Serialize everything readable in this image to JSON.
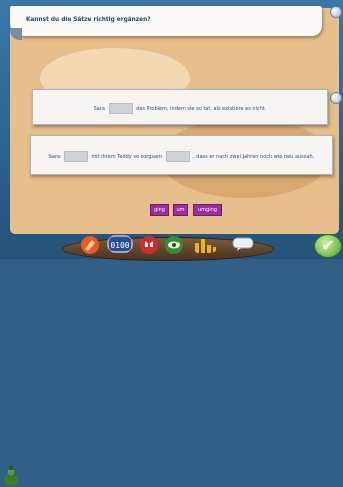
{
  "instruction": "Kannst du die Sätze richtig ergänzen?",
  "sentences": {
    "s1": {
      "part1": "Sara",
      "part2": "das Problem, indem sie so tat, als existiere es nicht."
    },
    "s2": {
      "part1": "Sara",
      "part2": "mit ihrem Teddy so sorgsam",
      "part3": ", dass er nach zwei Jahren noch wie neu aussah."
    }
  },
  "words": [
    "ging",
    "um",
    "umging"
  ],
  "toolbar": {
    "icons": [
      "pencil-icon",
      "calculator-icon",
      "magnet-icon",
      "eye-icon",
      "bars-chart-icon",
      "speech-bubble-icon"
    ]
  },
  "check_symbol": "✔",
  "colors": {
    "word_chip": "#9a2d9f",
    "field": "#e6bf8c",
    "text": "#2d4f7d"
  }
}
